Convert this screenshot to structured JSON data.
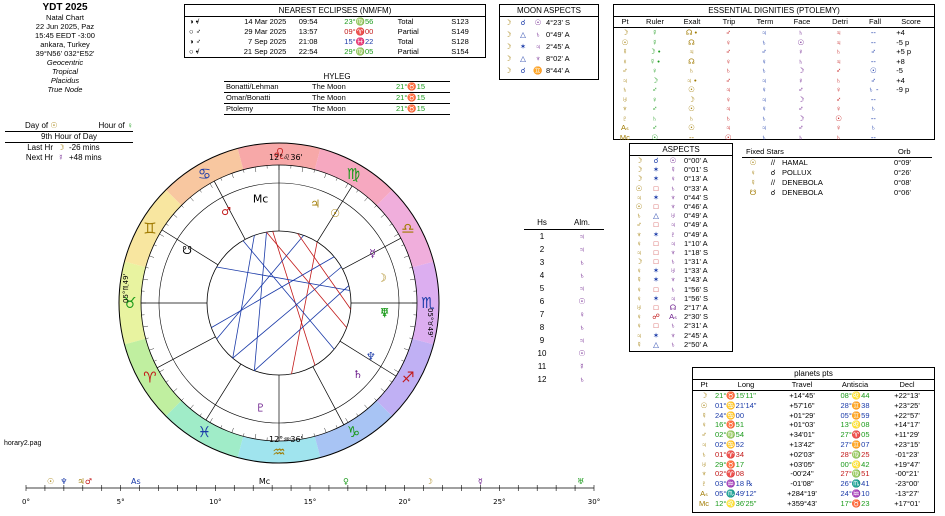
{
  "title_block": {
    "title": "YDT 2025",
    "lines": [
      "Natal Chart",
      "22 Jun 2025, Paz",
      "15:45  EEDT -3:00",
      "ankara, Turkey",
      "39°N56' 032°E52'",
      "Geocentric",
      "Tropical",
      "Placidus",
      "True Node"
    ]
  },
  "planetary_hour": {
    "day_of": "Day of",
    "hour_of": "Hour of",
    "hour_label": "9th Hour of Day",
    "last_hr_label": "Last Hr",
    "last_hr_value": "-26 mins",
    "next_hr_label": "Next Hr",
    "next_hr_value": "+48 mins"
  },
  "eclipses": {
    "title": "NEAREST ECLIPSES (NM/FM)",
    "rows": [
      {
        "date": "14 Mar 2025",
        "time": "09:54",
        "pos": "23°♍56",
        "type": "Total",
        "saros": "S123",
        "color": "#1a9a1a"
      },
      {
        "date": "29 Mar 2025",
        "time": "13:57",
        "pos": "09°♈00",
        "type": "Partial",
        "saros": "S149",
        "color": "#c21818"
      },
      {
        "date": "7 Sep 2025",
        "time": "21:08",
        "pos": "15°♓22",
        "type": "Total",
        "saros": "S128",
        "color": "#1a3aa8"
      },
      {
        "date": "21 Sep 2025",
        "time": "22:54",
        "pos": "29°♍05",
        "type": "Partial",
        "saros": "S154",
        "color": "#1a9a1a"
      }
    ]
  },
  "moon_aspects": {
    "title": "MOON ASPECTS",
    "rows": [
      {
        "asp": "☌",
        "pl": "☉",
        "orb": "4°23' S"
      },
      {
        "asp": "△",
        "pl": "♄",
        "orb": "0°49' A"
      },
      {
        "asp": "✶",
        "pl": "♃",
        "orb": "2°45' A"
      },
      {
        "asp": "△",
        "pl": "♆",
        "orb": "8°02' A"
      },
      {
        "asp": "☌",
        "pl": "♊",
        "orb": "8°44' A"
      }
    ]
  },
  "dignities": {
    "title": "ESSENTIAL DIGNITIES (PTOLEMY)",
    "headers": [
      "Pt",
      "Ruler",
      "Exalt",
      "Trip",
      "Term",
      "Face",
      "Detri",
      "Fall",
      "Score"
    ],
    "rows": [
      [
        "☽",
        "☿",
        "☊ •",
        "♂",
        "♃",
        "♄",
        "♃",
        "--",
        "+4"
      ],
      [
        "☉",
        "☿",
        "☊",
        "♀",
        "♄",
        "☉",
        "♃",
        "--",
        "-5 p"
      ],
      [
        "☿",
        "☽ •",
        "♃",
        "♂",
        "♂",
        "♀",
        "♄",
        "♂",
        "+5 p"
      ],
      [
        "♀",
        "☿ •",
        "☊",
        "♀",
        "♀",
        "♄",
        "♃",
        "--",
        "+8"
      ],
      [
        "♂",
        "♀",
        "♄",
        "♄",
        "♄",
        "☽",
        "♂",
        "☉",
        "-5"
      ],
      [
        "♃",
        "☽",
        "♃ •",
        "♂",
        "♃",
        "♀",
        "♄",
        "♂",
        "+4"
      ],
      [
        "♄",
        "♂",
        "☉",
        "♃",
        "♀",
        "♂",
        "♀",
        "♄ -",
        "-9 p"
      ],
      [
        "♅",
        "♀",
        "☽",
        "♀",
        "♃",
        "☽",
        "♂",
        "--",
        ""
      ],
      [
        "♆",
        "♂",
        "☉",
        "♃",
        "♀",
        "♂",
        "♀",
        "♄",
        ""
      ],
      [
        "♇",
        "♄",
        "♄",
        "♄",
        "♄",
        "☽",
        "☉",
        "--",
        ""
      ],
      [
        "Aₛ",
        "♂",
        "☉",
        "♃",
        "♃",
        "♂",
        "♀",
        "♄",
        ""
      ],
      [
        "Mc",
        "☉",
        "--",
        "☉",
        "♄",
        "♄",
        "♄",
        "--",
        ""
      ]
    ]
  },
  "hyleg": {
    "title": "HYLEG",
    "rows": [
      {
        "name": "Bonatti/Lehman",
        "body": "The Moon",
        "pos": "21°♉15"
      },
      {
        "name": "Omar/Bonatti",
        "body": "The Moon",
        "pos": "21°♉15"
      },
      {
        "name": "Ptolemy",
        "body": "The Moon",
        "pos": "21°♉15"
      }
    ]
  },
  "aspects": {
    "title": "ASPECTS",
    "rows": [
      [
        "☽",
        "☌",
        "☉",
        "0°00' A"
      ],
      [
        "☽",
        "✶",
        "☿",
        "0°01' S"
      ],
      [
        "☽",
        "✶",
        "♀",
        "0°13' A"
      ],
      [
        "☉",
        "□",
        "♄",
        "0°33' A"
      ],
      [
        "♃",
        "✶",
        "♆",
        "0°44' S"
      ],
      [
        "☉",
        "□",
        "♆",
        "0°46' A"
      ],
      [
        "♄",
        "△",
        "♅",
        "0°49' A"
      ],
      [
        "♂",
        "□",
        "♃",
        "0°49' A"
      ],
      [
        "♆",
        "✶",
        "♇",
        "0°49' A"
      ],
      [
        "♀",
        "□",
        "♃",
        "1°10' A"
      ],
      [
        "♃",
        "□",
        "♆",
        "1°18' S"
      ],
      [
        "☽",
        "□",
        "♄",
        "1°31' A"
      ],
      [
        "♀",
        "✶",
        "♅",
        "1°33' A"
      ],
      [
        "☿",
        "✶",
        "♆",
        "1°43' A"
      ],
      [
        "♀",
        "□",
        "♄",
        "1°56' S"
      ],
      [
        "♀",
        "✶",
        "♃",
        "1°56' S"
      ],
      [
        "♅",
        "□",
        "☊",
        "2°17' A"
      ],
      [
        "♀",
        "☍",
        "Aₛ",
        "2°30' S"
      ],
      [
        "♀",
        "□",
        "♄",
        "2°31' A"
      ],
      [
        "♃",
        "✶",
        "♆",
        "2°45' A"
      ],
      [
        "☿",
        "△",
        "♄",
        "2°50' A"
      ]
    ]
  },
  "fixed_stars": {
    "title": "Fixed Stars",
    "orb_header": "Orb",
    "rows": [
      {
        "pl": "☉",
        "asp": "//",
        "star": "HAMAL",
        "orb": "0°09'"
      },
      {
        "pl": "♀",
        "asp": "☌",
        "star": "POLLUX",
        "orb": "0°26'"
      },
      {
        "pl": "☿",
        "asp": "//",
        "star": "DENEBOLA",
        "orb": "0°08'"
      },
      {
        "pl": "☋",
        "asp": "☌",
        "star": "DENEBOLA",
        "orb": "0°06'"
      }
    ]
  },
  "houses": {
    "hs_header": "Hs",
    "alm_header": "Alm.",
    "rows": [
      [
        "1",
        "♃"
      ],
      [
        "2",
        "♃"
      ],
      [
        "3",
        "♄"
      ],
      [
        "4",
        "♄"
      ],
      [
        "5",
        "♃"
      ],
      [
        "6",
        "☉"
      ],
      [
        "7",
        "♀"
      ],
      [
        "8",
        "♄"
      ],
      [
        "9",
        "♃"
      ],
      [
        "10",
        "☉"
      ],
      [
        "11",
        "☿"
      ],
      [
        "12",
        "♄"
      ]
    ]
  },
  "planets_pts": {
    "title": "planets pts",
    "headers": [
      "Pt",
      "Long",
      "Travel",
      "Antiscia",
      "Decl"
    ],
    "rows": [
      {
        "pt": "☽",
        "long": "21°♉15'11\"",
        "travel": "+14°45'",
        "anti": "08°♌44",
        "decl": "+22°13'",
        "c": "#1a9a1a"
      },
      {
        "pt": "☉",
        "long": "01°♋21'14\"",
        "travel": "+57'16\"",
        "anti": "28°♊38",
        "decl": "+23°25'",
        "c": "#1a3aa8"
      },
      {
        "pt": "☿",
        "long": "24°♋00",
        "travel": "+01°29'",
        "anti": "05°♊59",
        "decl": "+22°57'",
        "c": "#1a3aa8"
      },
      {
        "pt": "♀",
        "long": "16°♉51",
        "travel": "+01°03'",
        "anti": "13°♌08",
        "decl": "+14°17'",
        "c": "#1a9a1a"
      },
      {
        "pt": "♂",
        "long": "02°♍54",
        "travel": "+34'01\"",
        "anti": "27°♈05",
        "decl": "+11°29'",
        "c": "#1a9a1a"
      },
      {
        "pt": "♃",
        "long": "02°♋52",
        "travel": "+13'42\"",
        "anti": "27°♊07",
        "decl": "+23°15'",
        "c": "#1a3aa8"
      },
      {
        "pt": "♄",
        "long": "01°♈34",
        "travel": "+02'03\"",
        "anti": "28°♍25",
        "decl": "-01°23'",
        "c": "#c21818"
      },
      {
        "pt": "♅",
        "long": "29°♉17",
        "travel": "+03'05\"",
        "anti": "00°♌42",
        "decl": "+19°47'",
        "c": "#1a9a1a"
      },
      {
        "pt": "♆",
        "long": "02°♈08",
        "travel": "-00'24\"",
        "anti": "27°♍51",
        "decl": "-00°21'",
        "c": "#c21818"
      },
      {
        "pt": "♇",
        "long": "03°♒18 ℞",
        "travel": "-01'08\"",
        "anti": "26°♏41",
        "decl": "-23°00'",
        "c": "#1a3aa8"
      },
      {
        "pt": "Aₛ",
        "long": "05°♏49'12\"",
        "travel": "+284°19'",
        "anti": "24°♒10",
        "decl": "-13°27'",
        "c": "#1a3aa8"
      },
      {
        "pt": "Mc",
        "long": "12°♌36'25\"",
        "travel": "+359°43'",
        "anti": "17°♉23",
        "decl": "+17°01'",
        "c": "#1a9a1a"
      }
    ]
  },
  "wheel": {
    "cusp_labels": {
      "mc": "12°♌36'",
      "ic": "12°♒36'",
      "asc": "05°♏49'",
      "dsc": "05°♉49'"
    },
    "signs": [
      {
        "g": "♌",
        "deg": 0,
        "c": "#c21818"
      },
      {
        "g": "♋",
        "deg": 30,
        "c": "#1a3aa8"
      },
      {
        "g": "♊",
        "deg": 60,
        "c": "#a07a00"
      },
      {
        "g": "♉",
        "deg": 90,
        "c": "#1a9a1a"
      },
      {
        "g": "♈",
        "deg": 120,
        "c": "#c21818"
      },
      {
        "g": "♓",
        "deg": 150,
        "c": "#1a3aa8"
      },
      {
        "g": "♒",
        "deg": 180,
        "c": "#a07a00"
      },
      {
        "g": "♑",
        "deg": 210,
        "c": "#1a9a1a"
      },
      {
        "g": "♐",
        "deg": 240,
        "c": "#c21818"
      },
      {
        "g": "♏",
        "deg": 270,
        "c": "#1a3aa8"
      },
      {
        "g": "♎",
        "deg": 300,
        "c": "#a07a00"
      },
      {
        "g": "♍",
        "deg": 330,
        "c": "#1a9a1a"
      }
    ],
    "planets": [
      {
        "g": "Mc",
        "deg": 100,
        "c": "#000"
      },
      {
        "g": "♂",
        "deg": 120,
        "c": "#c21818"
      },
      {
        "g": "♃",
        "deg": 70,
        "c": "#a07a00"
      },
      {
        "g": "☉",
        "deg": 58,
        "c": "#a07a00"
      },
      {
        "g": "☿",
        "deg": 28,
        "c": "#6a1a8a"
      },
      {
        "g": "☽",
        "deg": 14,
        "c": "#a07a00"
      },
      {
        "g": "♀",
        "deg": -5,
        "c": "#1a9a1a"
      },
      {
        "g": "♆",
        "deg": -30,
        "c": "#1a3aa8"
      },
      {
        "g": "♄",
        "deg": -42,
        "c": "#6a1a8a"
      },
      {
        "g": "♇",
        "deg": -100,
        "c": "#6a1a8a"
      },
      {
        "g": "☋",
        "deg": 150,
        "c": "#000"
      },
      {
        "g": "♅",
        "deg": -5,
        "c": "#1a9a1a"
      }
    ]
  },
  "footer": {
    "filename": "horary2.pag"
  },
  "degree_strip": {
    "ticks": [
      "0°",
      "5°",
      "10°",
      "15°",
      "20°",
      "25°",
      "30°"
    ]
  }
}
